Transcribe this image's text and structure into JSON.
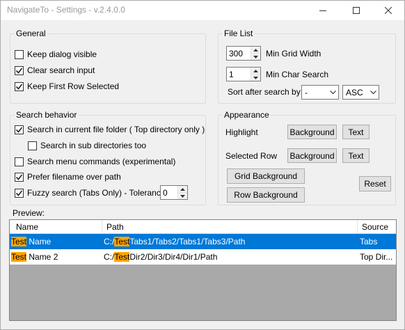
{
  "window": {
    "title": "NavigateTo - Settings - v.2.4.0.0"
  },
  "general": {
    "label": "General",
    "options": [
      {
        "label": "Keep dialog visible",
        "checked": false
      },
      {
        "label": "Clear search input",
        "checked": true
      },
      {
        "label": "Keep First Row Selected",
        "checked": true
      }
    ]
  },
  "file_list": {
    "label": "File List",
    "min_grid_width": {
      "value": "300",
      "label": "Min Grid Width"
    },
    "min_char_search": {
      "value": "1",
      "label": "Min Char Search"
    },
    "sort_label": "Sort after search by:",
    "sort_field": "-",
    "sort_order": "ASC"
  },
  "search_behavior": {
    "label": "Search behavior",
    "options": [
      {
        "label": "Search in current file folder ( Top directory only )",
        "checked": true
      },
      {
        "label": "Search in sub directories too",
        "checked": false
      },
      {
        "label": "Search menu commands (experimental)",
        "checked": false
      },
      {
        "label": "Prefer filename over path",
        "checked": true
      },
      {
        "label": "Fuzzy search (Tabs Only) - Tolerance:",
        "checked": true
      }
    ],
    "tolerance": "0"
  },
  "appearance": {
    "label": "Appearance",
    "highlight_label": "Highlight",
    "selected_row_label": "Selected Row",
    "background_button": "Background",
    "text_button": "Text",
    "grid_background_button": "Grid Background",
    "row_background_button": "Row Background",
    "reset_button": "Reset"
  },
  "preview": {
    "label": "Preview:",
    "columns": [
      "Name",
      "Path",
      "Source"
    ],
    "rows": [
      {
        "name_hl": "Test",
        "name_rest": " Name",
        "path_pre": "C:/",
        "path_hl": "Test",
        "path_rest": "Tabs1/Tabs2/Tabs1/Tabs3/Path",
        "source": "Tabs",
        "selected": true
      },
      {
        "name_hl": "Test",
        "name_rest": " Name 2",
        "path_pre": "C:/",
        "path_hl": "Test",
        "path_rest": "Dir2/Dir3/Dir4/Dir1/Path",
        "source": "Top Dir...",
        "selected": false
      }
    ],
    "colors": {
      "selection": "#0078d7",
      "highlight": "#ffa500",
      "grid_background": "#a9a9a9"
    }
  }
}
